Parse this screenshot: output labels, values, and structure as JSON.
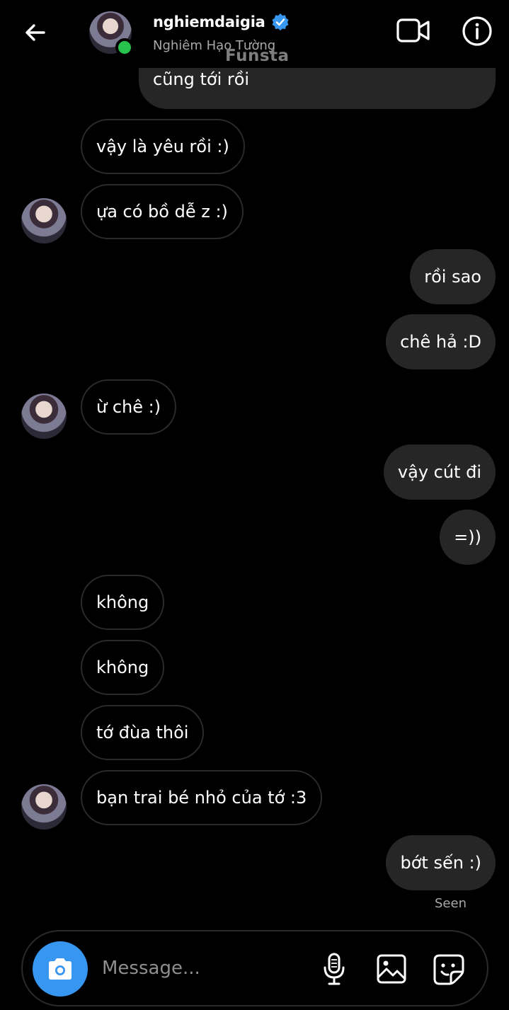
{
  "header": {
    "username": "nghiemdaigia",
    "fullname": "Nghiêm Hạo Tường",
    "watermark": "Funsta",
    "icons": {
      "back": "back-arrow-icon",
      "verified": "verified-badge-icon",
      "video": "video-call-icon",
      "info": "info-icon"
    }
  },
  "messages": {
    "partial": "cũng tới rồi",
    "m1": "vậy là yêu rồi :)",
    "m2": "ựa có bồ dễ z :)",
    "m3": "rồi sao",
    "m4": "chê hả :D",
    "m5": "ừ chê :)",
    "m6": "vậy cút đi",
    "m7": "=))",
    "m8": "không",
    "m9": "không",
    "m10": "tớ đùa thôi",
    "m11": "bạn trai bé nhỏ của tớ :3",
    "m12": "bớt sến :)"
  },
  "seen": "Seen",
  "composer": {
    "placeholder": "Message...",
    "icons": {
      "camera": "camera-icon",
      "mic": "microphone-icon",
      "gallery": "gallery-icon",
      "sticker": "sticker-icon"
    }
  },
  "colors": {
    "accent": "#3797f0",
    "outgoing_bubble": "#262626",
    "online": "#27c24c",
    "verified": "#3897f0"
  }
}
